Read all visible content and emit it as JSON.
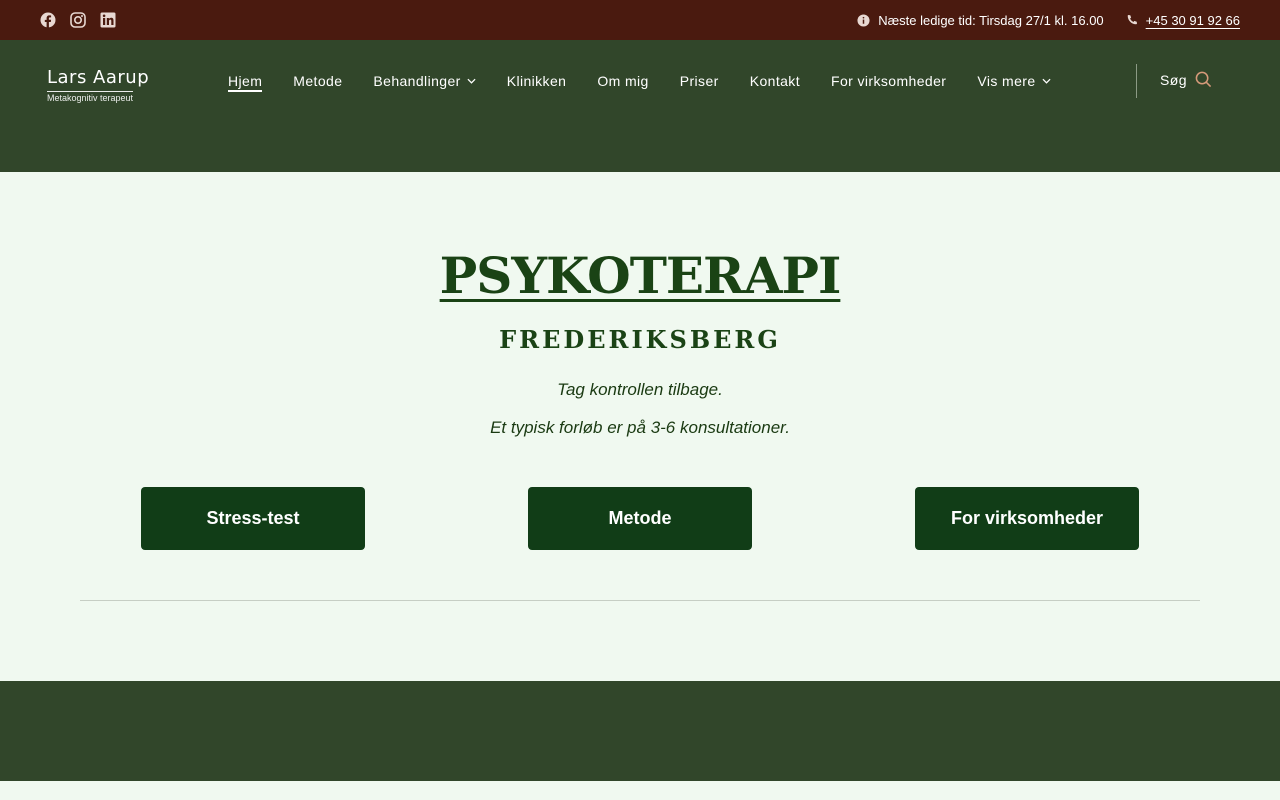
{
  "topbar": {
    "social": [
      {
        "icon": "facebook-icon"
      },
      {
        "icon": "instagram-icon"
      },
      {
        "icon": "linkedin-icon"
      }
    ],
    "next_available": "Næste ledige tid: Tirsdag 27/1 kl. 16.00",
    "phone": "+45 30 91 92 66"
  },
  "header": {
    "logo_name": "Lars Aarup",
    "logo_sub": "Metakognitiv terapeut",
    "nav": [
      {
        "label": "Hjem",
        "active": true
      },
      {
        "label": "Metode"
      },
      {
        "label": "Behandlinger",
        "dropdown": true
      },
      {
        "label": "Klinikken"
      },
      {
        "label": "Om mig"
      },
      {
        "label": "Priser"
      },
      {
        "label": "Kontakt"
      },
      {
        "label": "For virksomheder"
      },
      {
        "label": "Vis mere",
        "dropdown": true
      }
    ],
    "search_label": "Søg"
  },
  "hero": {
    "title": "PSYKOTERAPI",
    "subtitle": "FREDERIKSBERG",
    "tagline": "Tag kontrollen tilbage.",
    "info": "Et typisk forløb er på 3-6 konsultationer.",
    "buttons": [
      "Stress-test",
      "Metode",
      "For virksomheder"
    ]
  },
  "colors": {
    "topbar": "#4a1a0f",
    "nav": "#31462a",
    "page_bg": "#f0f9f0",
    "heading": "#1a4315",
    "button": "#113d17",
    "search_accent": "#d69a7a"
  }
}
